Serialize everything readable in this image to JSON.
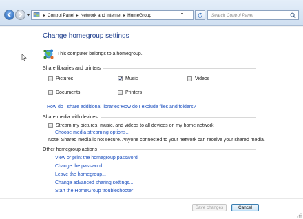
{
  "address_bar": {
    "crumbs": [
      "Control Panel",
      "Network and Internet",
      "HomeGroup"
    ],
    "search_placeholder": "Search Control Panel"
  },
  "page": {
    "title": "Change homegroup settings",
    "belongs_text": "This computer belongs to a homegroup."
  },
  "share_libraries": {
    "heading": "Share libraries and printers",
    "items": [
      {
        "label": "Pictures",
        "checked": false
      },
      {
        "label": "Music",
        "checked": true
      },
      {
        "label": "Videos",
        "checked": false
      },
      {
        "label": "Documents",
        "checked": false
      },
      {
        "label": "Printers",
        "checked": false
      }
    ],
    "link_additional": "How do I share additional libraries?",
    "link_exclude": "How do I exclude files and folders?"
  },
  "share_media": {
    "heading": "Share media with devices",
    "stream_label": "Stream my pictures, music, and videos to all devices on my home network",
    "stream_checked": false,
    "link_streaming": "Choose media streaming options...",
    "note": "Note: Shared media is not secure. Anyone connected to your network can receive your shared media."
  },
  "other_actions": {
    "heading": "Other homegroup actions",
    "links": [
      "View or print the homegroup password",
      "Change the password...",
      "Leave the homegroup...",
      "Change advanced sharing settings...",
      "Start the HomeGroup troubleshooter"
    ]
  },
  "buttons": {
    "save": "Save changes",
    "cancel": "Cancel"
  },
  "colors": {
    "link": "#1b4fbf",
    "title": "#1c3c8c"
  }
}
